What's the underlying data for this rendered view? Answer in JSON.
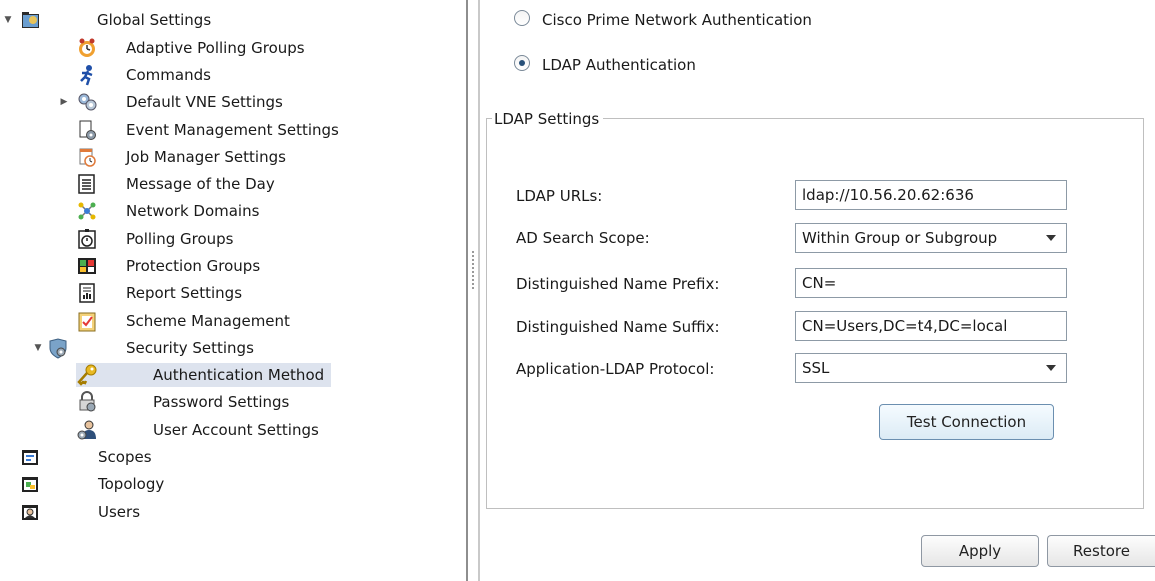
{
  "tree": {
    "root": {
      "label": "Global Settings",
      "expanded": true
    },
    "items": [
      {
        "label": "Adaptive Polling Groups",
        "icon": "clock-gear-icon"
      },
      {
        "label": "Commands",
        "icon": "running-man-icon"
      },
      {
        "label": "Default VNE Settings",
        "icon": "gear-cluster-icon",
        "collapsed": true
      },
      {
        "label": "Event Management Settings",
        "icon": "document-gear-icon"
      },
      {
        "label": "Job Manager Settings",
        "icon": "calendar-clock-icon"
      },
      {
        "label": "Message of the Day",
        "icon": "message-list-icon"
      },
      {
        "label": "Network Domains",
        "icon": "network-nodes-icon"
      },
      {
        "label": "Polling Groups",
        "icon": "stopwatch-icon"
      },
      {
        "label": "Protection Groups",
        "icon": "protection-group-icon"
      },
      {
        "label": "Report Settings",
        "icon": "report-icon"
      },
      {
        "label": "Scheme Management",
        "icon": "clipboard-check-icon"
      },
      {
        "label": "Security Settings",
        "icon": "shield-gear-icon",
        "expanded": true
      }
    ],
    "security_children": [
      {
        "label": "Authentication Method",
        "icon": "key-icon",
        "selected": true
      },
      {
        "label": "Password Settings",
        "icon": "lock-gear-icon"
      },
      {
        "label": "User Account Settings",
        "icon": "user-gear-icon"
      }
    ],
    "top_level": [
      {
        "label": "Scopes",
        "icon": "scopes-folder-icon"
      },
      {
        "label": "Topology",
        "icon": "topology-folder-icon"
      },
      {
        "label": "Users",
        "icon": "users-folder-icon"
      }
    ]
  },
  "auth": {
    "option_cpn": "Cisco Prime Network Authentication",
    "option_ldap": "LDAP Authentication",
    "selected": "ldap"
  },
  "ldap": {
    "legend": "LDAP Settings",
    "urls_label": "LDAP URLs:",
    "urls_value": "ldap://10.56.20.62:636",
    "scope_label": "AD Search Scope:",
    "scope_value": "Within Group or Subgroup",
    "prefix_label": "Distinguished Name Prefix:",
    "prefix_value": "CN=",
    "suffix_label": "Distinguished Name Suffix:",
    "suffix_value": "CN=Users,DC=t4,DC=local",
    "protocol_label": "Application-LDAP Protocol:",
    "protocol_value": "SSL",
    "test_button": "Test Connection"
  },
  "footer": {
    "apply": "Apply",
    "restore": "Restore"
  }
}
